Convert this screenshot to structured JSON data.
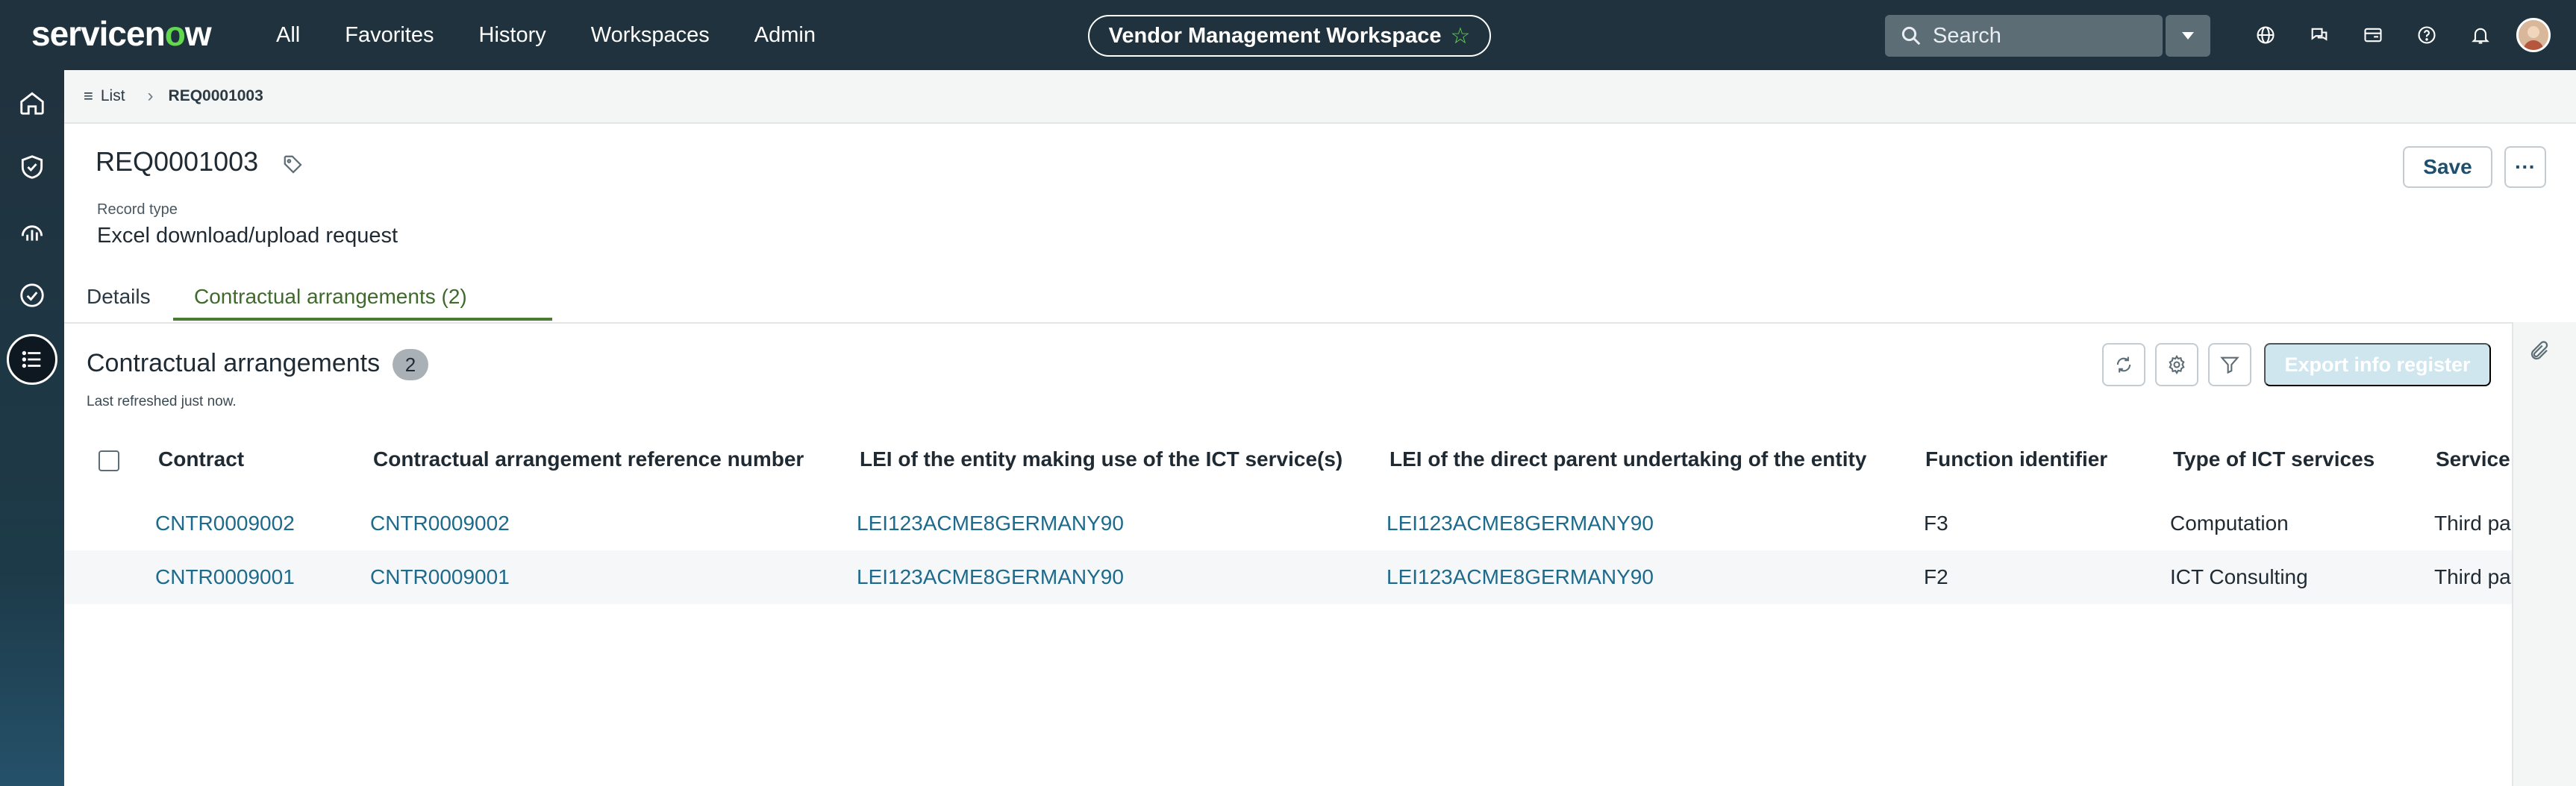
{
  "header": {
    "logo": {
      "text_a": "servicen",
      "text_o": "o",
      "text_b": "w"
    },
    "nav": [
      "All",
      "Favorites",
      "History",
      "Workspaces",
      "Admin"
    ],
    "workspace": "Vendor Management Workspace",
    "search_placeholder": "Search",
    "icons": [
      "globe-icon",
      "chat-icon",
      "card-icon",
      "help-icon",
      "bell-icon"
    ]
  },
  "rail": {
    "items": [
      "home-icon",
      "shield-check-icon",
      "analytics-icon",
      "check-circle-icon",
      "list-icon"
    ],
    "active": "list-icon"
  },
  "breadcrumb": {
    "list_label": "List",
    "current": "REQ0001003"
  },
  "record": {
    "number": "REQ0001003",
    "type_label": "Record type",
    "type_value": "Excel download/upload request",
    "save_label": "Save",
    "more_label": "···"
  },
  "tabs": {
    "details": "Details",
    "contract": "Contractual arrangements (2)"
  },
  "section": {
    "title": "Contractual arrangements",
    "count": "2",
    "refreshed": "Last refreshed just now.",
    "export_label": "Export info register"
  },
  "table": {
    "columns": [
      "Contract",
      "Contractual arrangement reference number",
      "LEI of the entity making use of the ICT service(s)",
      "LEI of the direct parent undertaking of the entity",
      "Function identifier",
      "Type of ICT services",
      "Service provider"
    ],
    "rows": [
      [
        "CNTR0009002",
        "CNTR0009002",
        "LEI123ACME8GERMANY90",
        "LEI123ACME8GERMANY90",
        "F3",
        "Computation",
        "Third party"
      ],
      [
        "CNTR0009001",
        "CNTR0009001",
        "LEI123ACME8GERMANY90",
        "LEI123ACME8GERMANY90",
        "F2",
        "ICT Consulting",
        "Third party"
      ]
    ]
  },
  "colors": {
    "nav_bg": "#1f323d",
    "accent_green": "#62d84e",
    "link": "#1d6a8c",
    "tab_active": "#4a7a33"
  }
}
